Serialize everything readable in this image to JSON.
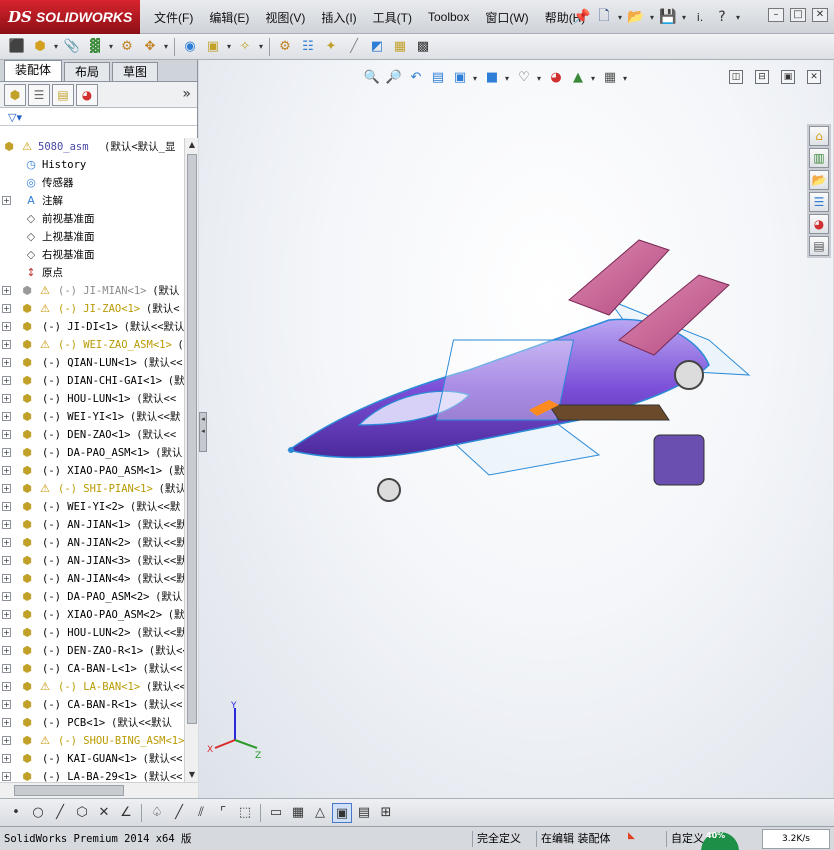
{
  "app": {
    "logo_ds": "DS",
    "logo_name": "SOLIDWORKS"
  },
  "menus": [
    "文件(F)",
    "编辑(E)",
    "视图(V)",
    "插入(I)",
    "工具(T)",
    "Toolbox",
    "窗口(W)",
    "帮助(H)"
  ],
  "quickaccess": {
    "options_text": "i.",
    "help_icon": "question-icon"
  },
  "panel_tabs": [
    "装配体",
    "布局",
    "草图"
  ],
  "tree": {
    "root_name": "5080_asm",
    "root_cfg": "(默认<默认_显",
    "fixed_items": [
      "History",
      "传感器",
      "注解",
      "前视基准面",
      "上视基准面",
      "右视基准面",
      "原点"
    ],
    "components": [
      {
        "name": "(-) JI-MIAN<1>",
        "cfg": "(默认",
        "style": "gray",
        "warn": true
      },
      {
        "name": "(-) JI-ZAO<1>",
        "cfg": "(默认<",
        "style": "yellow",
        "warn": true
      },
      {
        "name": "(-) JI-DI<1>",
        "cfg": "(默认<<默认",
        "style": "normal",
        "warn": false
      },
      {
        "name": "(-) WEI-ZAO_ASM<1>",
        "cfg": "(",
        "style": "yellow",
        "warn": true
      },
      {
        "name": "(-) QIAN-LUN<1>",
        "cfg": "(默认<<",
        "style": "normal",
        "warn": false
      },
      {
        "name": "(-) DIAN-CHI-GAI<1>",
        "cfg": "(默",
        "style": "normal",
        "warn": false
      },
      {
        "name": "(-) HOU-LUN<1>",
        "cfg": "(默认<<",
        "style": "normal",
        "warn": false
      },
      {
        "name": "(-) WEI-YI<1>",
        "cfg": "(默认<<默",
        "style": "normal",
        "warn": false
      },
      {
        "name": "(-) DEN-ZAO<1>",
        "cfg": "(默认<<",
        "style": "normal",
        "warn": false
      },
      {
        "name": "(-) DA-PAO_ASM<1>",
        "cfg": "(默认",
        "style": "normal",
        "warn": false
      },
      {
        "name": "(-) XIAO-PAO_ASM<1>",
        "cfg": "(默",
        "style": "normal",
        "warn": false
      },
      {
        "name": "(-) SHI-PIAN<1>",
        "cfg": "(默认",
        "style": "yellow",
        "warn": true
      },
      {
        "name": "(-) WEI-YI<2>",
        "cfg": "(默认<<默",
        "style": "normal",
        "warn": false
      },
      {
        "name": "(-) AN-JIAN<1>",
        "cfg": "(默认<<默",
        "style": "normal",
        "warn": false
      },
      {
        "name": "(-) AN-JIAN<2>",
        "cfg": "(默认<<默",
        "style": "normal",
        "warn": false
      },
      {
        "name": "(-) AN-JIAN<3>",
        "cfg": "(默认<<默",
        "style": "normal",
        "warn": false
      },
      {
        "name": "(-) AN-JIAN<4>",
        "cfg": "(默认<<默",
        "style": "normal",
        "warn": false
      },
      {
        "name": "(-) DA-PAO_ASM<2>",
        "cfg": "(默认",
        "style": "normal",
        "warn": false
      },
      {
        "name": "(-) XIAO-PAO_ASM<2>",
        "cfg": "(默",
        "style": "normal",
        "warn": false
      },
      {
        "name": "(-) HOU-LUN<2>",
        "cfg": "(默认<<默",
        "style": "normal",
        "warn": false
      },
      {
        "name": "(-) DEN-ZAO-R<1>",
        "cfg": "(默认<<",
        "style": "normal",
        "warn": false
      },
      {
        "name": "(-) CA-BAN-L<1>",
        "cfg": "(默认<<",
        "style": "normal",
        "warn": false
      },
      {
        "name": "(-) LA-BAN<1>",
        "cfg": "(默认<<",
        "style": "yellow",
        "warn": true
      },
      {
        "name": "(-) CA-BAN-R<1>",
        "cfg": "(默认<<",
        "style": "normal",
        "warn": false
      },
      {
        "name": "(-) PCB<1>",
        "cfg": "(默认<<默认",
        "style": "normal",
        "warn": false
      },
      {
        "name": "(-) SHOU-BING_ASM<1>",
        "cfg": "",
        "style": "yellow",
        "warn": true
      },
      {
        "name": "(-) KAI-GUAN<1>",
        "cfg": "(默认<<",
        "style": "normal",
        "warn": false
      },
      {
        "name": "(-) LA-BA-29<1>",
        "cfg": "(默认<<",
        "style": "normal",
        "warn": false
      }
    ]
  },
  "triad": {
    "x": "X",
    "y": "Y",
    "z": "Z"
  },
  "statusbar": {
    "app": "SolidWorks Premium 2014 x64 版",
    "defined": "完全定义",
    "editing": "在编辑 装配体",
    "custom": "自定义",
    "speed": "3.2K/s",
    "gauge": "40%"
  },
  "colors": {
    "brand_red": "#c8102e",
    "model_purple": "#7b4fd8",
    "fin_pink": "#d46a98",
    "edge_blue": "#2a8ad8"
  }
}
